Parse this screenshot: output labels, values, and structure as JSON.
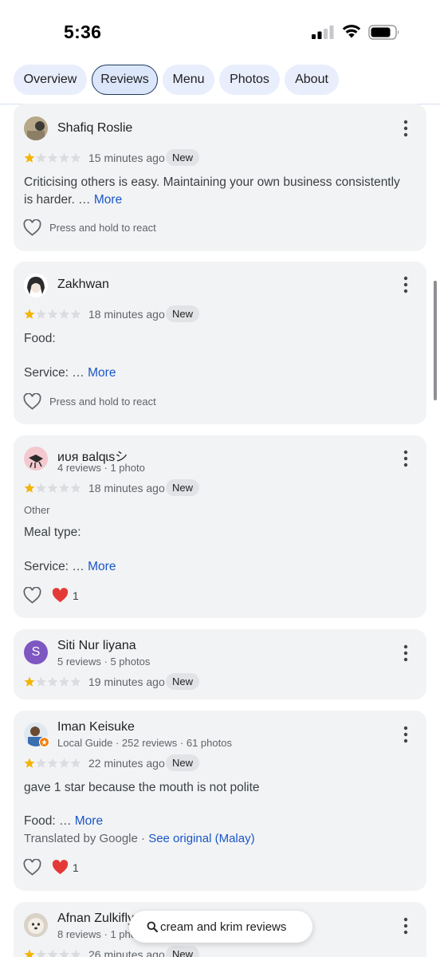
{
  "status_bar": {
    "time": "5:36"
  },
  "tabs": [
    {
      "label": "Overview"
    },
    {
      "label": "Reviews"
    },
    {
      "label": "Menu"
    },
    {
      "label": "Photos"
    },
    {
      "label": "About"
    }
  ],
  "reviews": [
    {
      "name": "Shafiq Roslie",
      "rating": 1,
      "time": "15 minutes ago",
      "badge": "New",
      "text": "Criticising others is easy. Maintaining your own business consistently is harder. …",
      "more": "More",
      "react_prompt": "Press and hold to react"
    },
    {
      "name": "Zakhwan",
      "rating": 1,
      "time": "18 minutes ago",
      "badge": "New",
      "text_line1": "Food:",
      "text_line2": "Service: …",
      "more": "More",
      "react_prompt": "Press and hold to react"
    },
    {
      "name": "ᴎᴜᴙ ʙalqɩsシ",
      "meta": "4 reviews · 1 photo",
      "rating": 1,
      "time": "18 minutes ago",
      "badge": "New",
      "category": "Other",
      "text_line1": "Meal type:",
      "text_line2": "Service: …",
      "more": "More",
      "reaction_count": "1"
    },
    {
      "name": "Siti Nur liyana",
      "avatar_letter": "S",
      "avatar_color": "#7e57c2",
      "meta": "5 reviews · 5 photos",
      "rating": 1,
      "time": "19 minutes ago",
      "badge": "New"
    },
    {
      "name": "Iman Keisuke",
      "meta": "Local Guide · 252 reviews · 61 photos",
      "rating": 1,
      "time": "22 minutes ago",
      "badge": "New",
      "text_line1": "gave 1 star because the mouth is not polite",
      "text_line2": "Food: …",
      "more": "More",
      "translated": "Translated by Google ·",
      "see_original": "See original (Malay)",
      "reaction_count": "1"
    },
    {
      "name": "Afnan Zulkifly",
      "meta": "8 reviews · 1 photo",
      "rating": 1,
      "time": "26 minutes ago",
      "badge": "New"
    }
  ],
  "search_pill": {
    "label": "cream and krim reviews"
  },
  "colors": {
    "star_filled": "#f4b400",
    "star_empty": "#dadce0",
    "link": "#1a56c8",
    "heart_red": "#e53935"
  }
}
